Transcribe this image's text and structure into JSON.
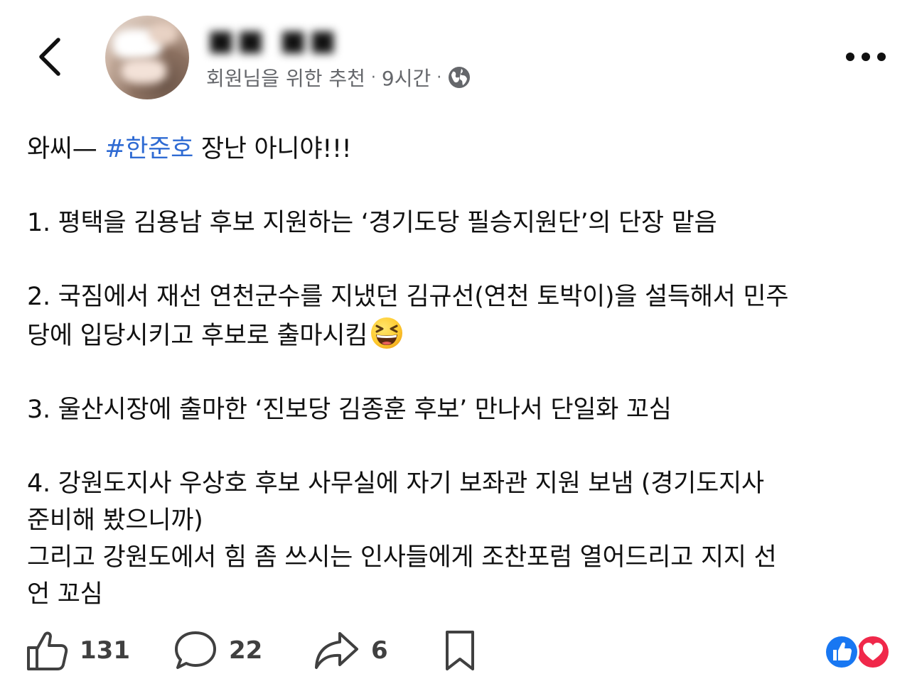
{
  "header": {
    "username": "■■ ■■",
    "meta_recommended": "회원님을 위한 추천",
    "meta_separator": "·",
    "meta_time": "9시간",
    "icons": {
      "back": "chevron-left-icon",
      "more": "more-horizontal-icon",
      "audience": "globe-icon"
    }
  },
  "post": {
    "line1_prefix": "와씨— ",
    "hashtag": "#한준호",
    "line1_suffix": " 장난 아니야!!!",
    "item1": "1. 평택을 김용남 후보 지원하는 ‘경기도당 필승지원단’의 단장 맡음",
    "item2_line1": "2. 국짐에서 재선 연천군수를 지냈던 김규선(연천 토박이)을 설득해서 민주",
    "item2_line2": "당에 입당시키고 후보로 출마시킴",
    "item2_emoji": "grinning-squinting-face",
    "item3": "3. 울산시장에 출마한 ‘진보당 김종훈 후보’ 만나서 단일화 꼬심",
    "item4_line1": "4. 강원도지사 우상호 후보 사무실에 자기 보좌관 지원 보냄 (경기도지사",
    "item4_line2": "준비해 봤으니까)",
    "item4_line3": "그리고 강원도에서 힘 좀 쓰시는 인사들에게 조찬포럼 열어드리고 지지 선",
    "item4_line4": "언 꼬심"
  },
  "actions": {
    "like_count": "131",
    "comment_count": "22",
    "share_count": "6",
    "icons": {
      "like": "thumbs-up-icon",
      "comment": "comment-bubble-icon",
      "share": "share-arrow-icon",
      "save": "bookmark-icon",
      "reactions": [
        "like-reaction-icon",
        "love-reaction-icon"
      ]
    }
  },
  "colors": {
    "hashtag": "#2f6bd3",
    "meta_text": "#65676b",
    "like_reaction": "#1877f2",
    "love_reaction": "#f0284a"
  }
}
